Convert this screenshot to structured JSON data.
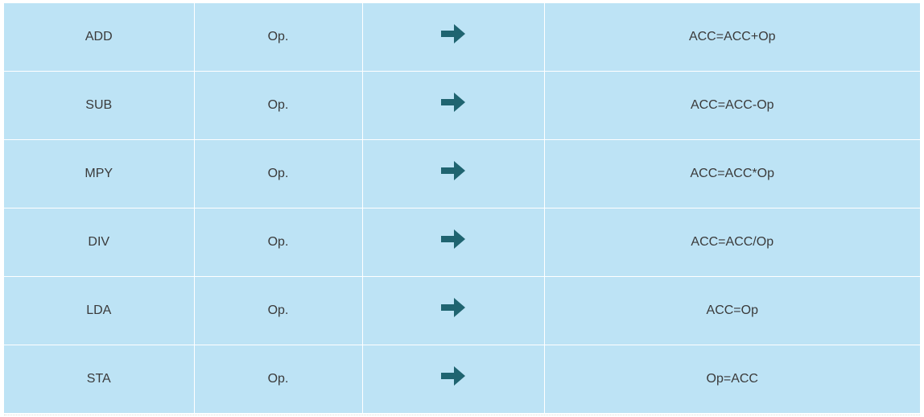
{
  "rows": [
    {
      "mnemonic": "ADD",
      "operand": "Op.",
      "icon": "arrow-right-icon",
      "result": "ACC=ACC+Op"
    },
    {
      "mnemonic": "SUB",
      "operand": "Op.",
      "icon": "arrow-right-icon",
      "result": "ACC=ACC-Op"
    },
    {
      "mnemonic": "MPY",
      "operand": "Op.",
      "icon": "arrow-right-icon",
      "result": "ACC=ACC*Op"
    },
    {
      "mnemonic": "DIV",
      "operand": "Op.",
      "icon": "arrow-right-icon",
      "result": "ACC=ACC/Op"
    },
    {
      "mnemonic": "LDA",
      "operand": "Op.",
      "icon": "arrow-right-icon",
      "result": "ACC=Op"
    },
    {
      "mnemonic": "STA",
      "operand": "Op.",
      "icon": "arrow-right-icon",
      "result": "Op=ACC"
    }
  ],
  "colors": {
    "cell_background": "#bde3f5",
    "text": "#3a3a3a",
    "arrow": "#1f6470"
  }
}
